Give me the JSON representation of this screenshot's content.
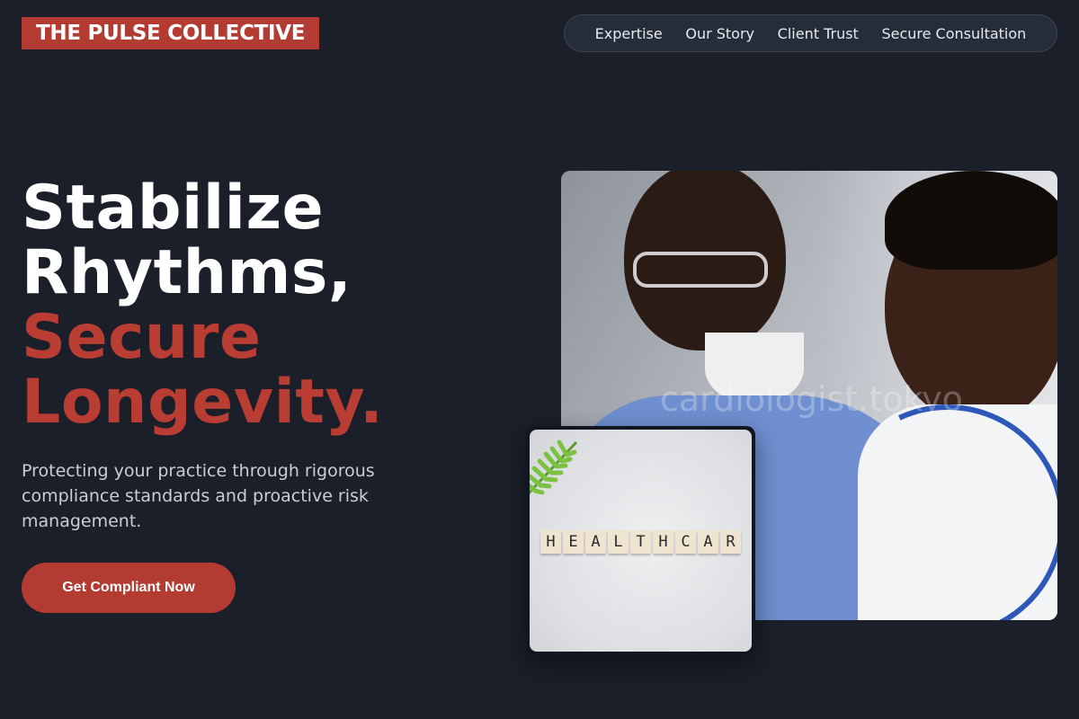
{
  "brand": {
    "name": "THE PULSE COLLECTIVE",
    "accent": "#b33b32",
    "background": "#1a1f2a"
  },
  "nav": {
    "items": [
      {
        "label": "Expertise"
      },
      {
        "label": "Our Story"
      },
      {
        "label": "Client Trust"
      },
      {
        "label": "Secure Consultation"
      }
    ]
  },
  "hero": {
    "headline_white_1": "Stabilize",
    "headline_white_2": "Rhythms,",
    "headline_red_1": "Secure",
    "headline_red_2": "Longevity.",
    "subtext": "Protecting your practice through rigorous compliance standards and proactive risk management.",
    "cta_label": "Get Compliant Now"
  },
  "images": {
    "main_watermark": "cardiologist.tokyo",
    "card_tiles": [
      "H",
      "E",
      "A",
      "L",
      "T",
      "H",
      "C",
      "A",
      "R"
    ]
  }
}
